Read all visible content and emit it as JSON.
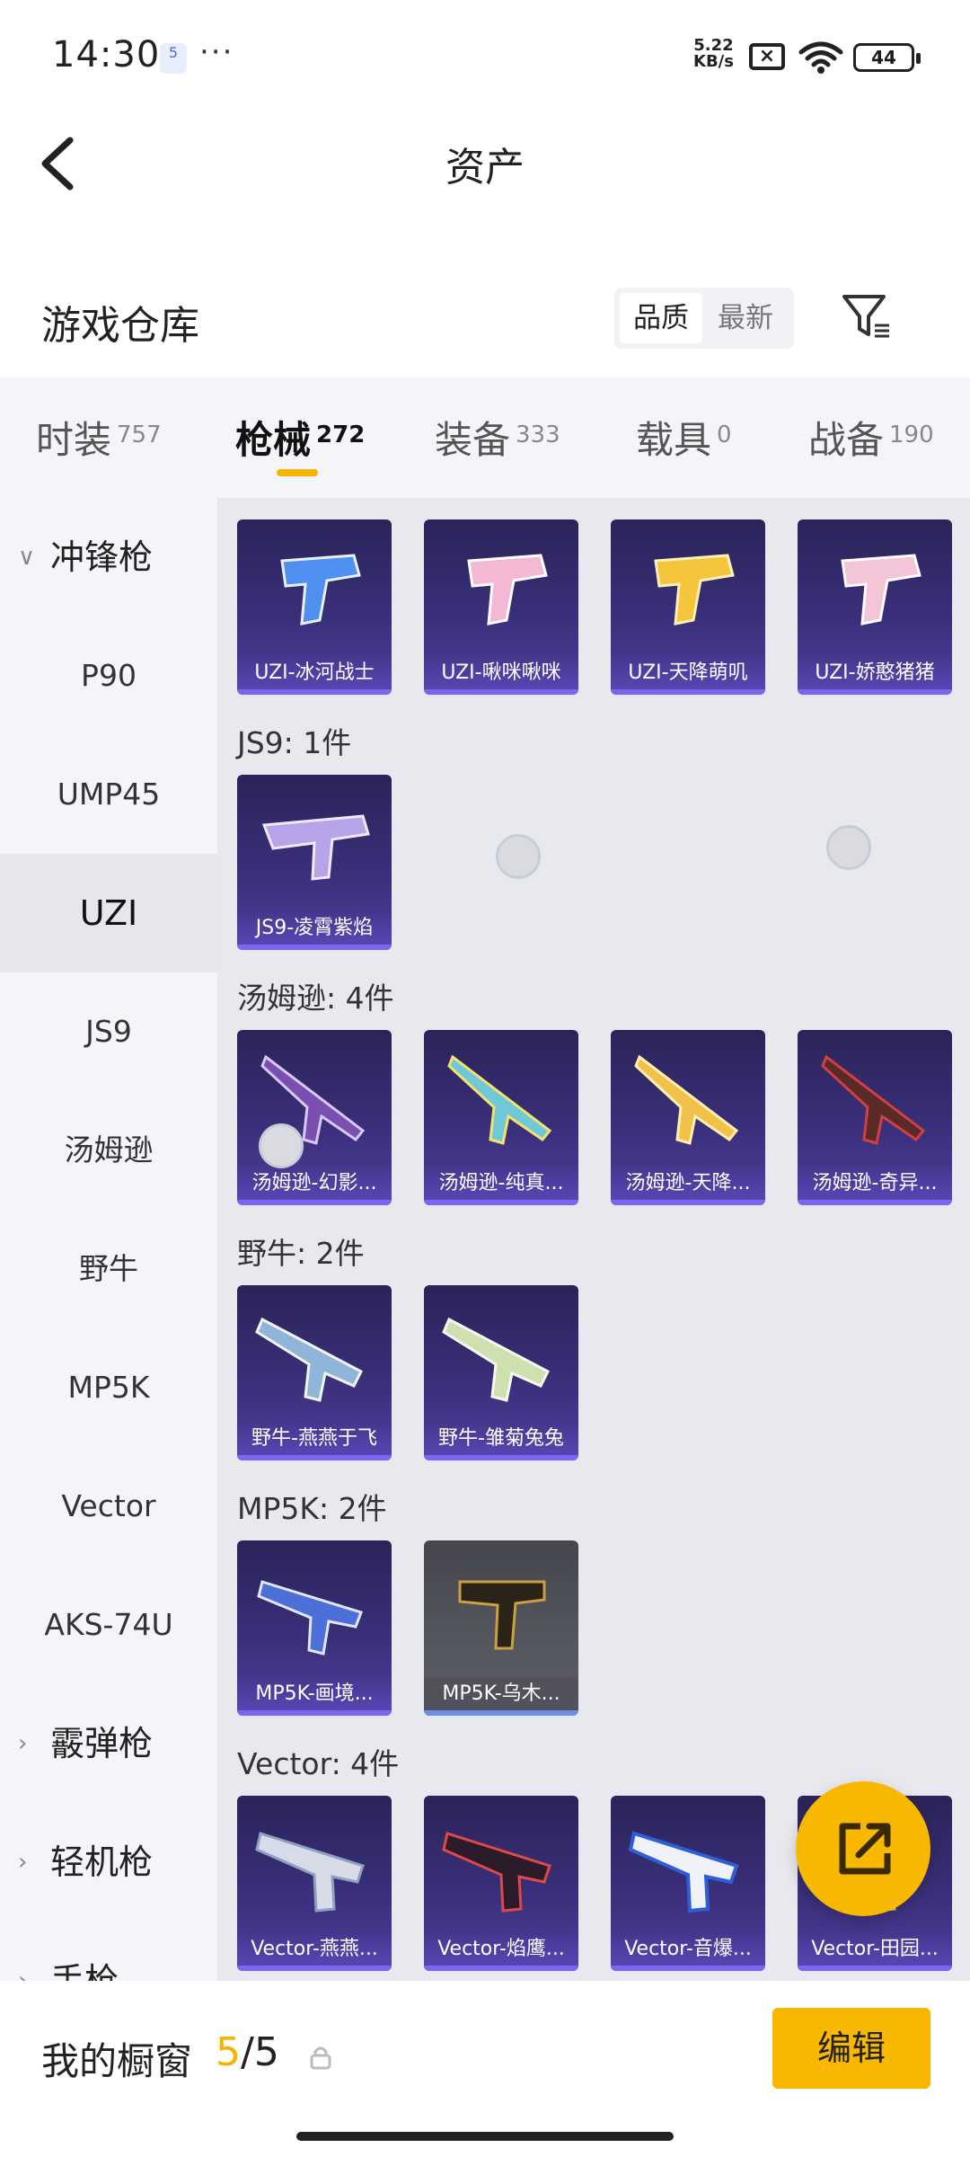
{
  "status_bar": {
    "time": "14:30",
    "notif_icon": "5",
    "dots": "···",
    "net_speed_value": "5.22",
    "net_speed_unit": "KB/s",
    "battery": "44"
  },
  "header": {
    "title": "资产"
  },
  "warehouse": {
    "title": "游戏仓库",
    "sort_options": [
      "品质",
      "最新"
    ],
    "sort_selected": "品质"
  },
  "tabs": [
    {
      "label": "时装",
      "count": "757"
    },
    {
      "label": "枪械",
      "count": "272",
      "active": true
    },
    {
      "label": "装备",
      "count": "333"
    },
    {
      "label": "载具",
      "count": "0"
    },
    {
      "label": "战备",
      "count": "190"
    }
  ],
  "sidebar": {
    "group_open": "冲锋枪",
    "items": [
      "P90",
      "UMP45",
      "UZI",
      "JS9",
      "汤姆逊",
      "野牛",
      "MP5K",
      "Vector",
      "AKS-74U"
    ],
    "active_item": "UZI",
    "groups_collapsed": [
      "霰弹枪",
      "轻机枪",
      "手枪"
    ]
  },
  "sections": {
    "uzi": {
      "items": [
        "UZI-冰河战士",
        "UZI-啾咪啾咪",
        "UZI-天降萌叽",
        "UZI-娇憨猪猪"
      ]
    },
    "js9": {
      "label": "JS9: 1件",
      "items": [
        "JS9-凌霄紫焰"
      ]
    },
    "tommy": {
      "label": "汤姆逊: 4件",
      "items": [
        "汤姆逊-幻影...",
        "汤姆逊-纯真...",
        "汤姆逊-天降...",
        "汤姆逊-奇异..."
      ]
    },
    "bison": {
      "label": "野牛: 2件",
      "items": [
        "野牛-燕燕于飞",
        "野牛-雏菊兔兔"
      ]
    },
    "mp5k": {
      "label": "MP5K: 2件",
      "items": [
        "MP5K-画境...",
        "MP5K-乌木..."
      ]
    },
    "vector": {
      "label": "Vector: 4件",
      "items": [
        "Vector-燕燕...",
        "Vector-焰鹰...",
        "Vector-音爆...",
        "Vector-田园..."
      ]
    }
  },
  "colors": {
    "accent": "#f8b800",
    "card_purple": "#3a2f7a",
    "card_grey": "#55565e"
  },
  "bottom_bar": {
    "label": "我的橱窗",
    "count_current": "5",
    "count_total": "/5",
    "edit_label": "编辑"
  }
}
